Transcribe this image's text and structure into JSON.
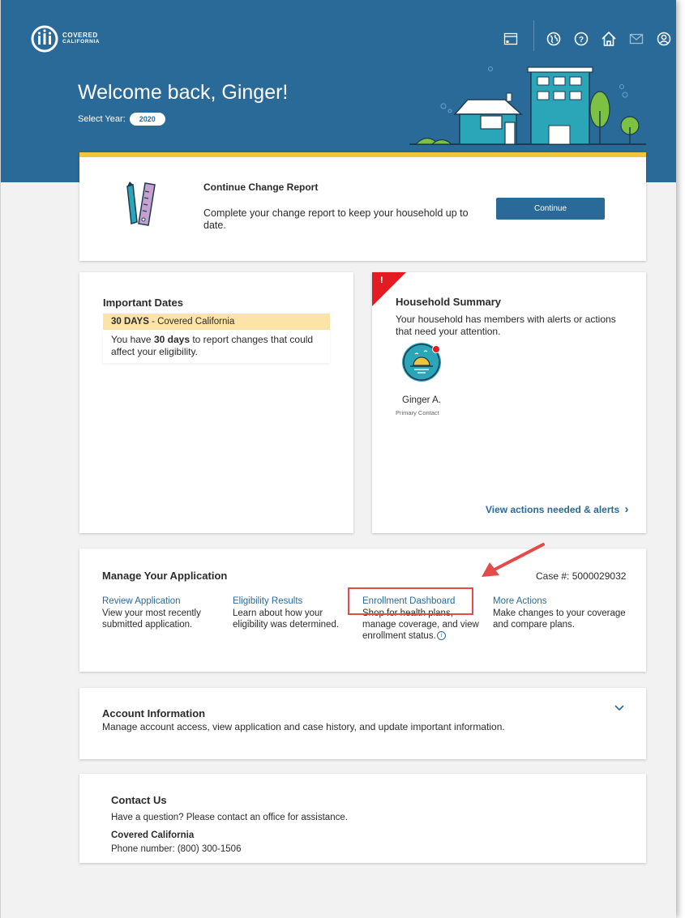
{
  "brand": {
    "line1": "COVERED",
    "line2": "CALIFORNIA"
  },
  "header": {
    "icons": [
      "calendar-icon",
      "globe-icon",
      "help-icon",
      "home-icon",
      "mail-icon",
      "user-icon"
    ],
    "welcome": "Welcome back, Ginger!",
    "select_year_label": "Select Year:",
    "year": "2020"
  },
  "change_report": {
    "title": "Continue Change Report",
    "description": "Complete your change report to keep your household up to date.",
    "button": "Continue"
  },
  "important_dates": {
    "title": "Important Dates",
    "alert_days": "30 DAYS",
    "alert_source": " - Covered California",
    "body_pre": "You have ",
    "body_bold": "30 days",
    "body_post": " to report changes that could affect your eligibility."
  },
  "household": {
    "title": "Household Summary",
    "description": "Your household has members with alerts or actions that need your attention.",
    "flag": "!",
    "member_name": "Ginger A.",
    "member_role": "Primary Contact",
    "link": "View actions needed & alerts",
    "link_chevron": "›"
  },
  "manage": {
    "title": "Manage Your Application",
    "case_number": "Case #: 5000029032",
    "columns": [
      {
        "link": "Review Application",
        "desc": "View your most recently submitted application."
      },
      {
        "link": "Eligibility Results",
        "desc": "Learn about how your eligibility was determined."
      },
      {
        "link": "Enrollment Dashboard",
        "desc": "Shop for health plans, manage coverage, and view enrollment status."
      },
      {
        "link": "More Actions",
        "desc": "Make changes to your coverage and compare plans."
      }
    ],
    "info_icon": "i"
  },
  "account": {
    "title": "Account Information",
    "description": "Manage account access, view application and case history, and update important information."
  },
  "contact": {
    "title": "Contact Us",
    "description": "Have a question? Please contact an office for assistance.",
    "org": "Covered California",
    "phone": "Phone number: (800) 300-1506"
  },
  "colors": {
    "header_blue": "#2a6a98",
    "accent_yellow": "#f2c43c",
    "alert_red": "#e31b23",
    "annotation_red": "#e34a4a"
  }
}
